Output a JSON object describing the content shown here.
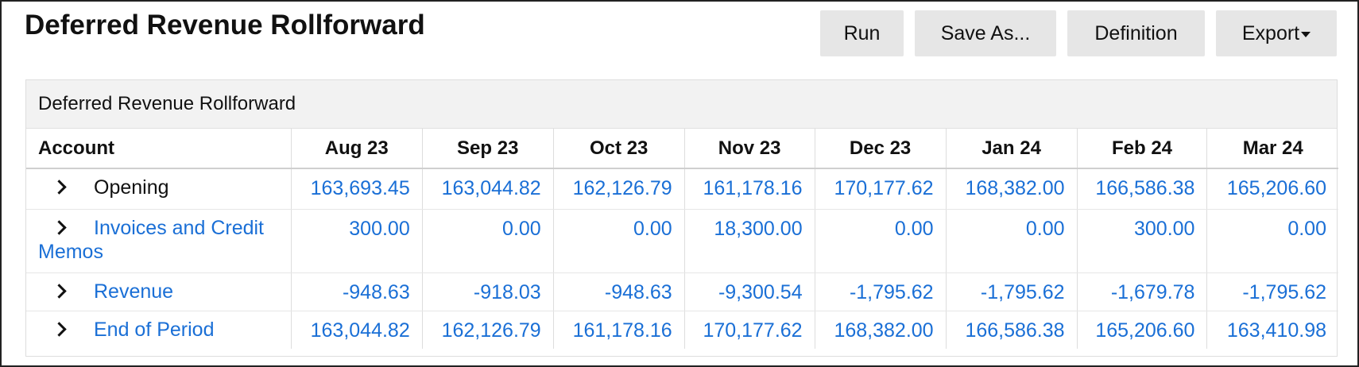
{
  "page": {
    "title": "Deferred Revenue Rollforward"
  },
  "toolbar": {
    "run_label": "Run",
    "save_as_label": "Save As...",
    "definition_label": "Definition",
    "export_label": "Export"
  },
  "report": {
    "title": "Deferred Revenue Rollforward",
    "columns": [
      "Account",
      "Aug 23",
      "Sep 23",
      "Oct 23",
      "Nov 23",
      "Dec 23",
      "Jan 24",
      "Feb 24",
      "Mar 24"
    ],
    "rows": [
      {
        "account": "Opening",
        "values": [
          "163,693.45",
          "163,044.82",
          "162,126.79",
          "161,178.16",
          "170,177.62",
          "168,382.00",
          "166,586.38",
          "165,206.60"
        ]
      },
      {
        "account": "Invoices and Credit Memos",
        "values": [
          "300.00",
          "0.00",
          "0.00",
          "18,300.00",
          "0.00",
          "0.00",
          "300.00",
          "0.00"
        ]
      },
      {
        "account": "Revenue",
        "values": [
          "-948.63",
          "-918.03",
          "-948.63",
          "-9,300.54",
          "-1,795.62",
          "-1,795.62",
          "-1,679.78",
          "-1,795.62"
        ]
      },
      {
        "account": "End of Period",
        "values": [
          "163,044.82",
          "162,126.79",
          "161,178.16",
          "170,177.62",
          "168,382.00",
          "166,586.38",
          "165,206.60",
          "163,410.98"
        ]
      }
    ]
  },
  "icons": {
    "expand": "chevron-right-icon",
    "dropdown": "caret-down-icon"
  },
  "colors": {
    "link": "#1a6fd6",
    "header_bg": "#f2f2f2",
    "button_bg": "#e6e6e6"
  }
}
